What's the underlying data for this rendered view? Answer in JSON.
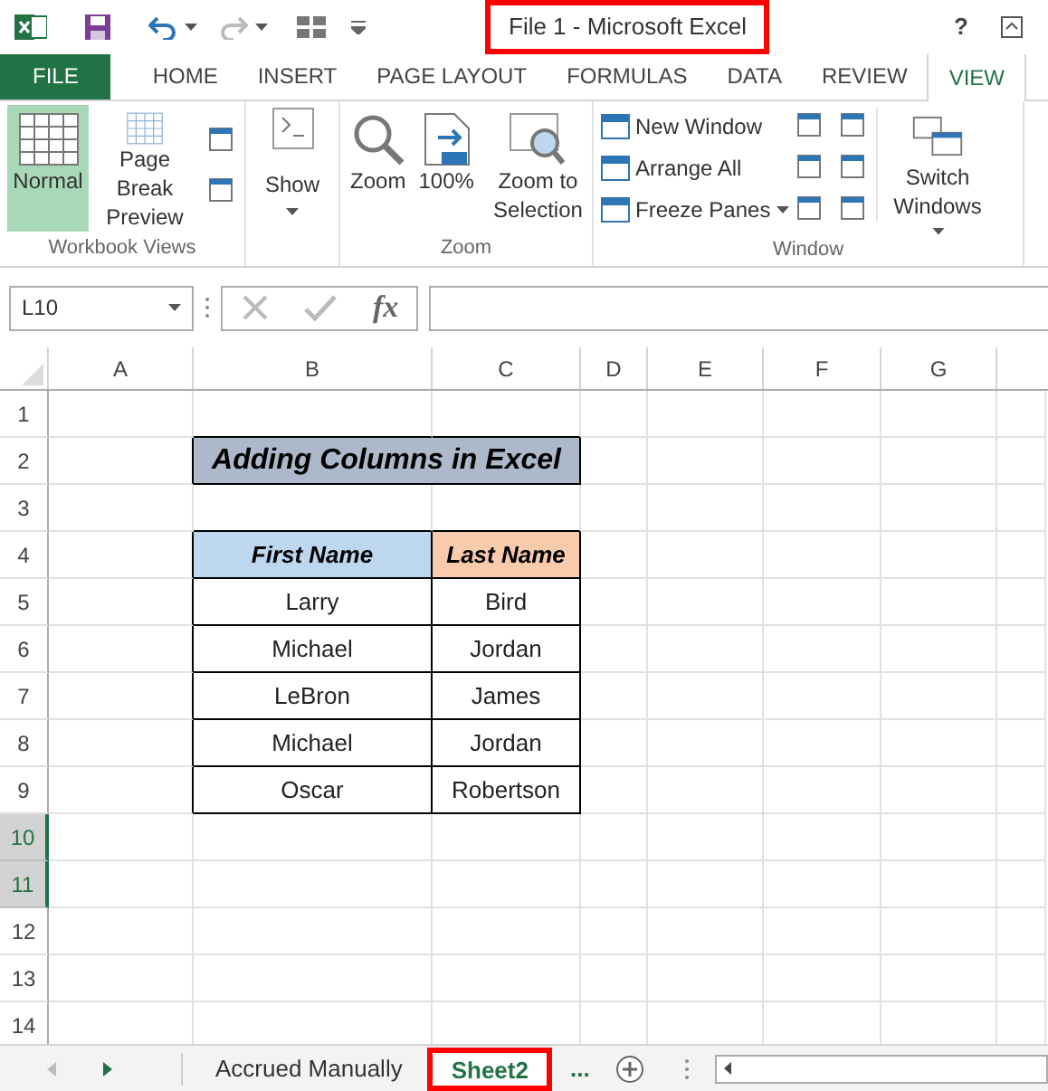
{
  "title_bar": {
    "title": "File 1 - Microsoft Excel",
    "title_annotated": true,
    "help": "?"
  },
  "ribbon_tabs": [
    {
      "label": "FILE",
      "kind": "file",
      "selected": false
    },
    {
      "label": "HOME",
      "kind": "tab",
      "selected": false
    },
    {
      "label": "INSERT",
      "kind": "tab",
      "selected": false
    },
    {
      "label": "PAGE LAYOUT",
      "kind": "tab",
      "selected": false
    },
    {
      "label": "FORMULAS",
      "kind": "tab",
      "selected": false
    },
    {
      "label": "DATA",
      "kind": "tab",
      "selected": false
    },
    {
      "label": "REVIEW",
      "kind": "tab",
      "selected": false
    },
    {
      "label": "VIEW",
      "kind": "tab",
      "selected": true
    }
  ],
  "ribbon": {
    "workbook_views": {
      "label": "Workbook Views",
      "normal": {
        "label": "Normal",
        "selected": true
      },
      "page_break": {
        "label": "Page Break Preview",
        "selected": false
      }
    },
    "show": {
      "label": "Show"
    },
    "zoom": {
      "label": "Zoom",
      "zoom": "Zoom",
      "hundred": "100%",
      "to_selection": "Zoom to Selection"
    },
    "window": {
      "label": "Window",
      "new_window": "New Window",
      "arrange_all": "Arrange All",
      "freeze_panes": "Freeze Panes",
      "switch_windows": "Switch Windows"
    }
  },
  "name_box": {
    "value": "L10"
  },
  "formula_bar": {
    "function_label": "fx"
  },
  "columns": [
    "A",
    "B",
    "C",
    "D",
    "E",
    "F",
    "G"
  ],
  "rows": [
    {
      "number": "1",
      "highlighted": false
    },
    {
      "number": "2",
      "highlighted": false
    },
    {
      "number": "3",
      "highlighted": false
    },
    {
      "number": "4",
      "highlighted": false
    },
    {
      "number": "5",
      "highlighted": false
    },
    {
      "number": "6",
      "highlighted": false
    },
    {
      "number": "7",
      "highlighted": false
    },
    {
      "number": "8",
      "highlighted": false
    },
    {
      "number": "9",
      "highlighted": false
    },
    {
      "number": "10",
      "highlighted": true
    },
    {
      "number": "11",
      "highlighted": true
    },
    {
      "number": "12",
      "highlighted": false
    },
    {
      "number": "13",
      "highlighted": false
    },
    {
      "number": "14",
      "highlighted": false
    }
  ],
  "sheet_title": "Adding Columns in Excel",
  "table": {
    "columns": [
      {
        "label": "First Name",
        "color": "#bdd7ee"
      },
      {
        "label": "Last Name",
        "color": "#f8cbad"
      }
    ],
    "rows": [
      [
        "Larry",
        "Bird"
      ],
      [
        "Michael",
        "Jordan"
      ],
      [
        "LeBron",
        "James"
      ],
      [
        "Michael",
        "Jordan"
      ],
      [
        "Oscar",
        "Robertson"
      ]
    ]
  },
  "sheet_tabs": [
    {
      "label": "Accrued Manually",
      "selected": false,
      "annotated": false
    },
    {
      "label": "Sheet2",
      "selected": true,
      "annotated": true
    }
  ],
  "more_sheets": "..."
}
